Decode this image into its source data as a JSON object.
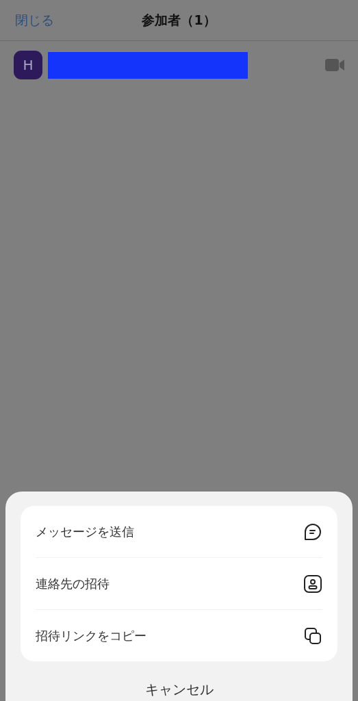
{
  "header": {
    "close": "閉じる",
    "title": "参加者（1）"
  },
  "participants": [
    {
      "initial": "H"
    }
  ],
  "action_sheet": {
    "actions": [
      {
        "label": "メッセージを送信"
      },
      {
        "label": "連絡先の招待"
      },
      {
        "label": "招待リンクをコピー"
      }
    ],
    "cancel": "キャンセル"
  }
}
